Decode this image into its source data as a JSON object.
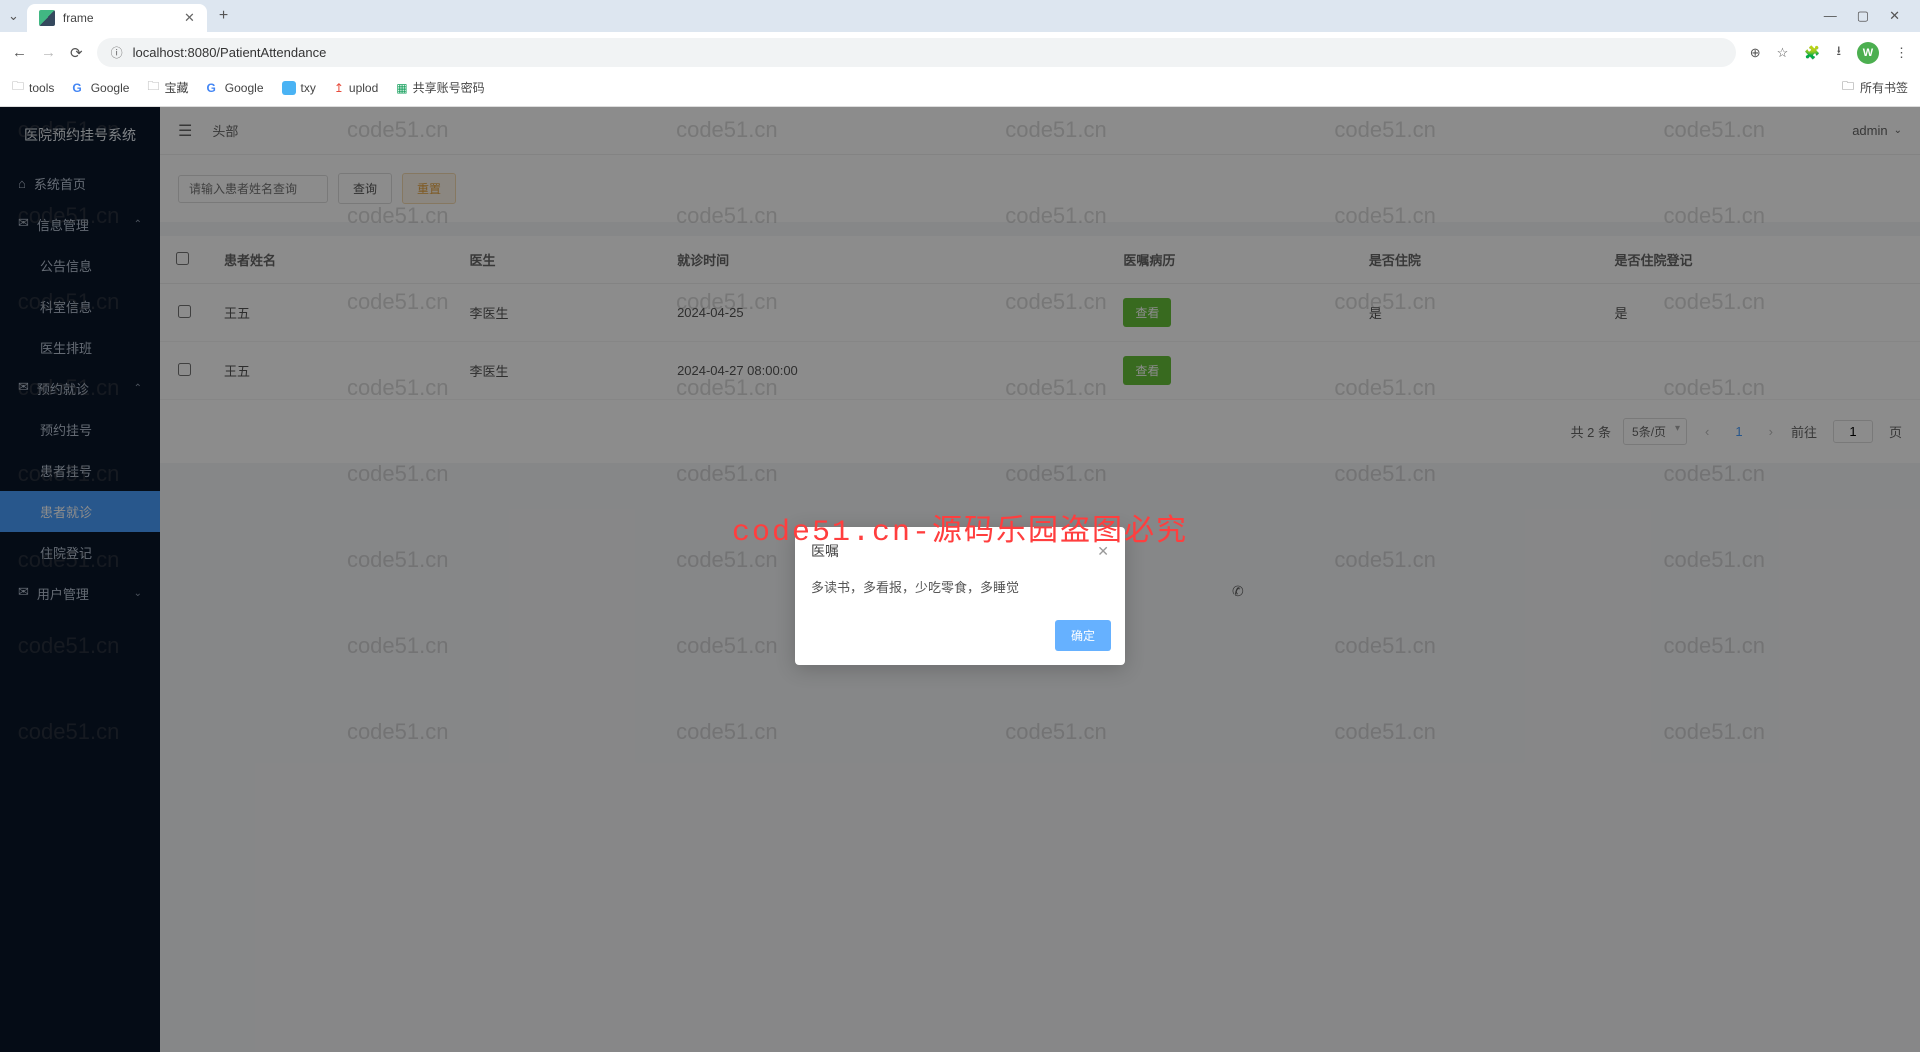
{
  "browser": {
    "tab_title": "frame",
    "url": "localhost:8080/PatientAttendance",
    "avatar_letter": "W",
    "bookmarks": [
      "tools",
      "Google",
      "宝藏",
      "Google",
      "txy",
      "uplod",
      "共享账号密码"
    ],
    "all_bookmarks": "所有书签"
  },
  "sidebar": {
    "title": "医院预约挂号系统",
    "items": [
      {
        "label": "系统首页",
        "icon": "⌂",
        "type": "item"
      },
      {
        "label": "信息管理",
        "icon": "✉",
        "type": "group"
      },
      {
        "label": "公告信息",
        "type": "sub"
      },
      {
        "label": "科室信息",
        "type": "sub"
      },
      {
        "label": "医生排班",
        "type": "sub"
      },
      {
        "label": "预约就诊",
        "icon": "✉",
        "type": "group"
      },
      {
        "label": "预约挂号",
        "type": "sub"
      },
      {
        "label": "患者挂号",
        "type": "sub"
      },
      {
        "label": "患者就诊",
        "type": "sub",
        "active": true
      },
      {
        "label": "住院登记",
        "type": "sub"
      },
      {
        "label": "用户管理",
        "icon": "✉",
        "type": "group"
      }
    ]
  },
  "topbar": {
    "title": "头部",
    "user": "admin"
  },
  "search": {
    "placeholder": "请输入患者姓名查询",
    "btn_query": "查询",
    "btn_reset": "重置"
  },
  "table": {
    "headers": [
      "患者姓名",
      "医生",
      "就诊时间",
      "医嘱病历",
      "是否住院",
      "是否住院登记"
    ],
    "rows": [
      {
        "name": "王五",
        "doctor": "李医生",
        "time": "2024-04-25",
        "view": "查看",
        "hospitalize": "是",
        "registered": "是"
      },
      {
        "name": "王五",
        "doctor": "李医生",
        "time": "2024-04-27 08:00:00",
        "view": "查看",
        "hospitalize": "",
        "registered": ""
      }
    ]
  },
  "pagination": {
    "total_label": "共 2 条",
    "page_size": "5条/页",
    "current": "1",
    "goto_prefix": "前往",
    "goto_suffix": "页",
    "goto_value": "1"
  },
  "dialog": {
    "title": "医嘱",
    "body": "多读书，多看报，少吃零食，多睡觉",
    "ok": "确定"
  },
  "watermark": {
    "text": "code51.cn",
    "banner": "code51.cn-源码乐园盗图必究"
  }
}
